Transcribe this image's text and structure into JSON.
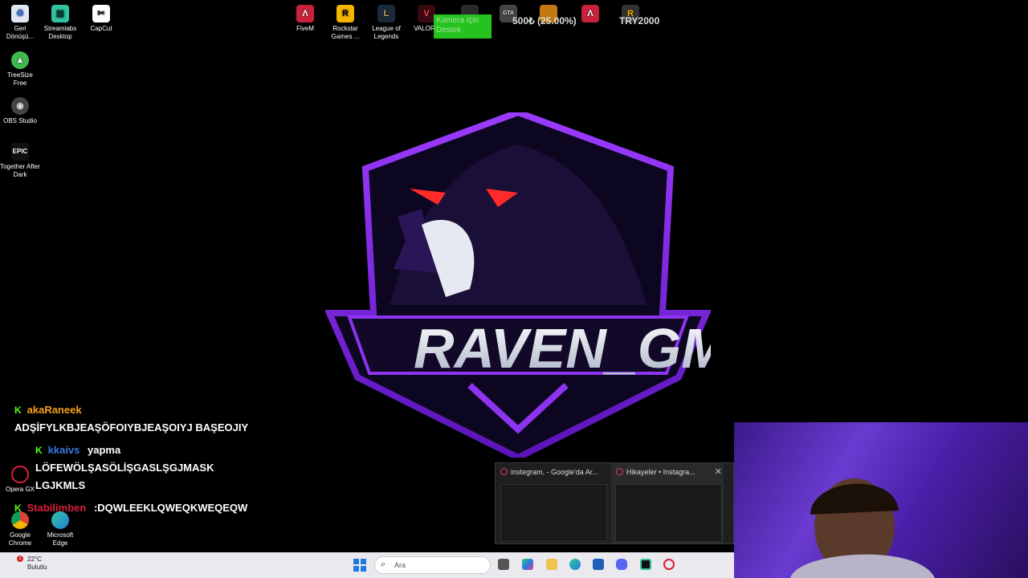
{
  "desktop_icons": [
    {
      "id": "recycle",
      "label": "Geri Dönüşü..."
    },
    {
      "id": "streamlabs",
      "label": "Streamlabs Desktop"
    },
    {
      "id": "capcut",
      "label": "CapCut"
    },
    {
      "id": "treesize",
      "label": "TreeSize Free"
    },
    {
      "id": "obs",
      "label": "OBS Studio"
    },
    {
      "id": "epic",
      "label": "Together After Dark"
    },
    {
      "id": "fivem",
      "label": "FiveM"
    },
    {
      "id": "rockstar",
      "label": "Rockstar Games ..."
    },
    {
      "id": "lol",
      "label": "League of Legends"
    },
    {
      "id": "valorant",
      "label": "VALORA"
    },
    {
      "id": "operagx",
      "label": "Opera GX"
    },
    {
      "id": "chrome",
      "label": "Google Chrome"
    },
    {
      "id": "edge",
      "label": "Microsoft Edge"
    }
  ],
  "goal": {
    "label": "Kamera İçin Destek",
    "amount": "500₺ (25.00%)",
    "target": "TRY2000",
    "progress": 0.25
  },
  "logo": {
    "text": "RAVEN_GM"
  },
  "chat": [
    {
      "user": "akaRaneek",
      "color": "#f4a11d",
      "text": "ADŞİFYLKBJEAŞÖFOIYBJEAŞOIYJ BAŞEOJIY"
    },
    {
      "user": "kkaivs",
      "color": "#3a78e0",
      "text": "yapma LÖFEWÖLŞASÖLİŞGASLŞGJMASK LGJKMLS"
    },
    {
      "user": "Stabilimben",
      "color": "#d81f3c",
      "text": ":DQWLEEKLQWEQKWEQEQW"
    }
  ],
  "tabs": [
    {
      "title": "instegram. - Google'da Ar..."
    },
    {
      "title": "Hikayeler • Instagra..."
    }
  ],
  "taskbar": {
    "weather_temp": "22°C",
    "weather_desc": "Bulutlu",
    "weather_badge": "1",
    "search_placeholder": "Ara"
  }
}
